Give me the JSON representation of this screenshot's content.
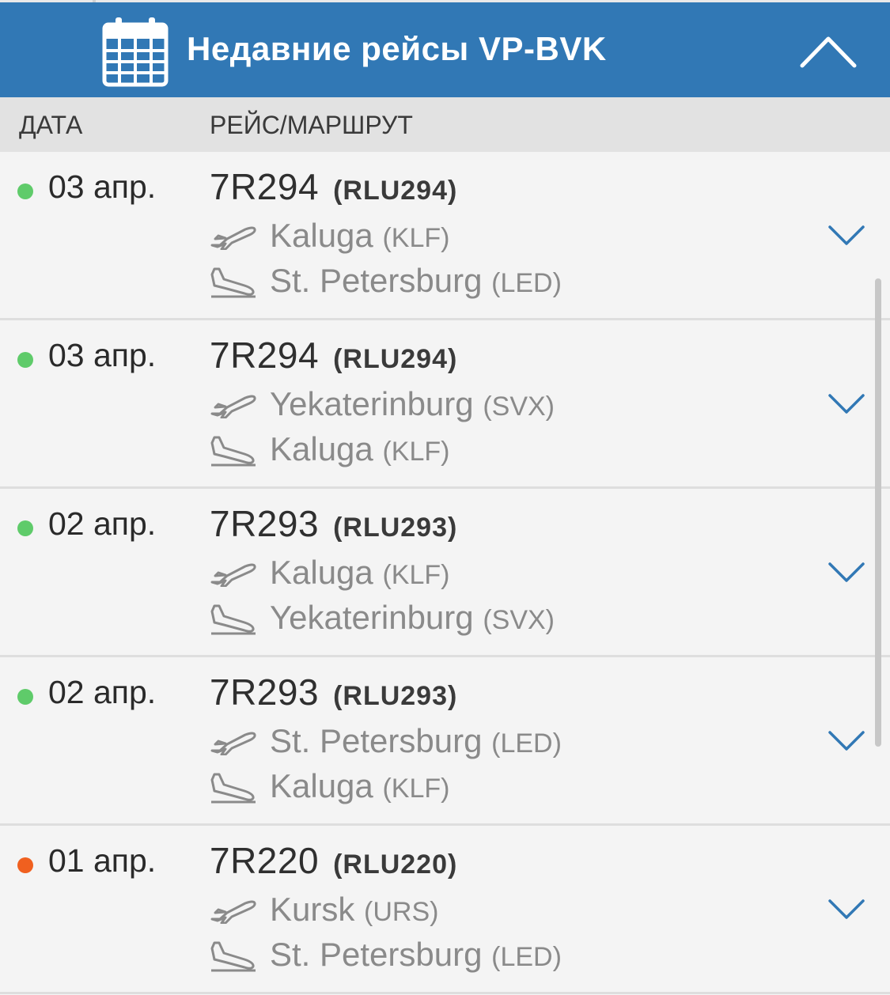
{
  "header": {
    "title": "Недавние рейсы VP-BVK",
    "bg_color": "#3178b5"
  },
  "columns": {
    "date": "ДАТА",
    "route": "РЕЙС/МАРШРУТ"
  },
  "colors": {
    "status_ok": "#5fcb6a",
    "status_warn": "#f0601f",
    "chevron": "#3178b5"
  },
  "flights": [
    {
      "date": "03 апр.",
      "status": "green",
      "flight_number": "7R294",
      "callsign": "(RLU294)",
      "from_city": "Kaluga",
      "from_code": "(KLF)",
      "to_city": "St. Petersburg",
      "to_code": "(LED)"
    },
    {
      "date": "03 апр.",
      "status": "green",
      "flight_number": "7R294",
      "callsign": "(RLU294)",
      "from_city": "Yekaterinburg",
      "from_code": "(SVX)",
      "to_city": "Kaluga",
      "to_code": "(KLF)"
    },
    {
      "date": "02 апр.",
      "status": "green",
      "flight_number": "7R293",
      "callsign": "(RLU293)",
      "from_city": "Kaluga",
      "from_code": "(KLF)",
      "to_city": "Yekaterinburg",
      "to_code": "(SVX)"
    },
    {
      "date": "02 апр.",
      "status": "green",
      "flight_number": "7R293",
      "callsign": "(RLU293)",
      "from_city": "St. Petersburg",
      "from_code": "(LED)",
      "to_city": "Kaluga",
      "to_code": "(KLF)"
    },
    {
      "date": "01 апр.",
      "status": "orange",
      "flight_number": "7R220",
      "callsign": "(RLU220)",
      "from_city": "Kursk",
      "from_code": "(URS)",
      "to_city": "St. Petersburg",
      "to_code": "(LED)"
    }
  ]
}
